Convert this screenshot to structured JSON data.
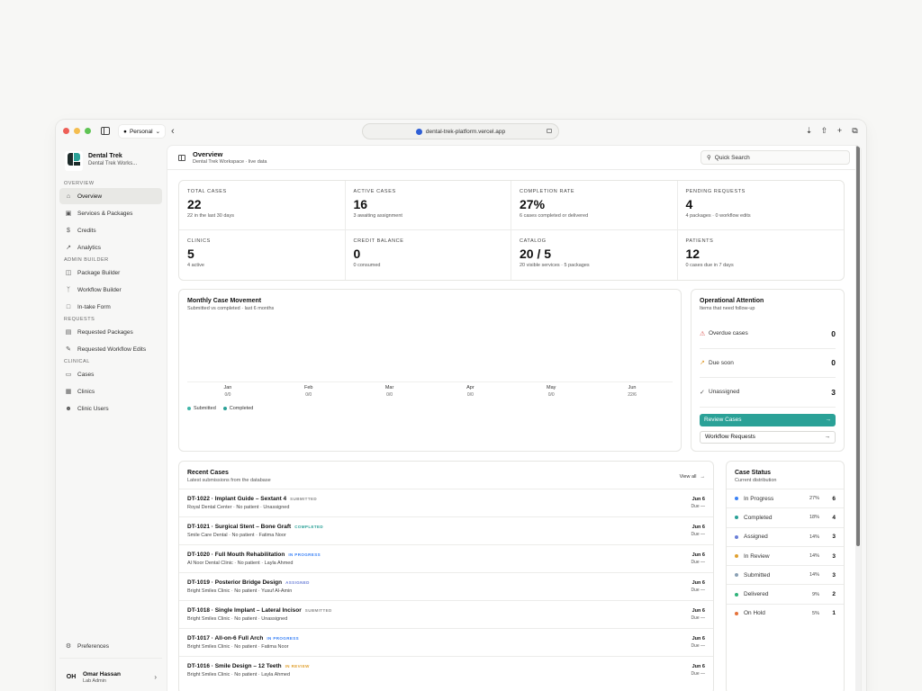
{
  "browser": {
    "profile": "Personal",
    "url": "dental-trek-platform.vercel.app"
  },
  "brand": {
    "name": "Dental Trek",
    "workspace": "Dental Trek Works..."
  },
  "nav": {
    "sections": [
      {
        "title": "OVERVIEW",
        "items": [
          {
            "label": "Overview",
            "icon": "home-icon",
            "active": true
          },
          {
            "label": "Services & Packages",
            "icon": "box-icon"
          },
          {
            "label": "Credits",
            "icon": "dollar-icon"
          },
          {
            "label": "Analytics",
            "icon": "trend-icon"
          }
        ]
      },
      {
        "title": "ADMIN BUILDER",
        "items": [
          {
            "label": "Package Builder",
            "icon": "package-icon"
          },
          {
            "label": "Workflow Builder",
            "icon": "workflow-icon"
          },
          {
            "label": "In-take Form",
            "icon": "form-icon"
          }
        ]
      },
      {
        "title": "REQUESTS",
        "items": [
          {
            "label": "Requested Packages",
            "icon": "inbox-icon"
          },
          {
            "label": "Requested Workflow Edits",
            "icon": "edit-icon"
          }
        ]
      },
      {
        "title": "CLINICAL",
        "items": [
          {
            "label": "Cases",
            "icon": "folder-icon"
          },
          {
            "label": "Clinics",
            "icon": "building-icon"
          },
          {
            "label": "Clinic Users",
            "icon": "users-icon"
          }
        ]
      }
    ],
    "preferences": "Preferences"
  },
  "user": {
    "initials": "OH",
    "name": "Omar Hassan",
    "role": "Lab Admin"
  },
  "header": {
    "title": "Overview",
    "subtitle": "Dental Trek Workspace · live data",
    "search_label": "Quick Search"
  },
  "stats": [
    {
      "label": "TOTAL CASES",
      "value": "22",
      "sub": "22 in the last 30 days"
    },
    {
      "label": "ACTIVE CASES",
      "value": "16",
      "sub": "3 awaiting assignment"
    },
    {
      "label": "COMPLETION RATE",
      "value": "27%",
      "sub": "6 cases completed or delivered"
    },
    {
      "label": "PENDING REQUESTS",
      "value": "4",
      "sub": "4 packages · 0 workflow edits"
    },
    {
      "label": "CLINICS",
      "value": "5",
      "sub": "4 active"
    },
    {
      "label": "CREDIT BALANCE",
      "value": "0",
      "sub": "0 consumed"
    },
    {
      "label": "CATALOG",
      "value": "20 / 5",
      "sub": "20 visible services · 5 packages"
    },
    {
      "label": "PATIENTS",
      "value": "12",
      "sub": "0 cases due in 7 days"
    }
  ],
  "chart": {
    "title": "Monthly Case Movement",
    "subtitle": "Submitted vs completed · last 6 months"
  },
  "chart_data": {
    "type": "bar",
    "title": "Monthly Case Movement",
    "subtitle": "Submitted vs completed · last 6 months",
    "categories": [
      "Jan",
      "Feb",
      "Mar",
      "Apr",
      "May",
      "Jun"
    ],
    "category_labels": [
      "0/0",
      "0/0",
      "0/0",
      "0/0",
      "0/0",
      "22/6"
    ],
    "series": [
      {
        "name": "Submitted",
        "values": [
          0,
          0,
          0,
          0,
          0,
          22
        ],
        "color": "#3fb5a8"
      },
      {
        "name": "Completed",
        "values": [
          0,
          0,
          0,
          0,
          0,
          6
        ],
        "color": "#2aa197"
      }
    ],
    "legend": "bottom-left"
  },
  "ops": {
    "title": "Operational Attention",
    "subtitle": "Items that need follow-up",
    "rows": [
      {
        "label": "Overdue cases",
        "count": "0",
        "icon": "warning-icon",
        "color": "#d9534f"
      },
      {
        "label": "Due soon",
        "count": "0",
        "icon": "trend-up-icon",
        "color": "#e09b2d"
      },
      {
        "label": "Unassigned",
        "count": "3",
        "icon": "check-circle-icon",
        "color": "#555555"
      }
    ],
    "primary_button": "Review Cases",
    "secondary_button": "Workflow Requests"
  },
  "cases": {
    "title": "Recent Cases",
    "subtitle": "Latest submissions from the database",
    "view_all": "View all",
    "rows": [
      {
        "title": "DT-1022 · Implant Guide – Sextant 4",
        "status": "SUBMITTED",
        "status_color": "#8a8a8a",
        "meta": "Royal Dental Center · No patient · Unassigned",
        "date": "Jun 6",
        "due": "Due —"
      },
      {
        "title": "DT-1021 · Surgical Stent – Bone Graft",
        "status": "COMPLETED",
        "status_color": "#2aa197",
        "meta": "Smile Care Dental · No patient · Fatima Noor",
        "date": "Jun 6",
        "due": "Due —"
      },
      {
        "title": "DT-1020 · Full Mouth Rehabilitation",
        "status": "IN PROGRESS",
        "status_color": "#3b82f6",
        "meta": "Al Noor Dental Clinic · No patient · Layla Ahmed",
        "date": "Jun 6",
        "due": "Due —"
      },
      {
        "title": "DT-1019 · Posterior Bridge Design",
        "status": "ASSIGNED",
        "status_color": "#6b7fd7",
        "meta": "Bright Smiles Clinic · No patient · Yusuf Al-Amin",
        "date": "Jun 6",
        "due": "Due —"
      },
      {
        "title": "DT-1018 · Single Implant – Lateral Incisor",
        "status": "SUBMITTED",
        "status_color": "#8a8a8a",
        "meta": "Bright Smiles Clinic · No patient · Unassigned",
        "date": "Jun 6",
        "due": "Due —"
      },
      {
        "title": "DT-1017 · All-on-6 Full Arch",
        "status": "IN PROGRESS",
        "status_color": "#3b82f6",
        "meta": "Bright Smiles Clinic · No patient · Fatima Noor",
        "date": "Jun 6",
        "due": "Due —"
      },
      {
        "title": "DT-1016 · Smile Design – 12 Teeth",
        "status": "IN REVIEW",
        "status_color": "#e0a030",
        "meta": "Bright Smiles Clinic · No patient · Layla Ahmed",
        "date": "Jun 6",
        "due": "Due —"
      }
    ]
  },
  "status": {
    "title": "Case Status",
    "subtitle": "Current distribution",
    "rows": [
      {
        "label": "In Progress",
        "pct": "27%",
        "count": "6",
        "color": "#3b82f6"
      },
      {
        "label": "Completed",
        "pct": "18%",
        "count": "4",
        "color": "#2aa197"
      },
      {
        "label": "Assigned",
        "pct": "14%",
        "count": "3",
        "color": "#6b7fd7"
      },
      {
        "label": "In Review",
        "pct": "14%",
        "count": "3",
        "color": "#e0a030"
      },
      {
        "label": "Submitted",
        "pct": "14%",
        "count": "3",
        "color": "#8aa0b4"
      },
      {
        "label": "Delivered",
        "pct": "9%",
        "count": "2",
        "color": "#2fb37a"
      },
      {
        "label": "On Hold",
        "pct": "5%",
        "count": "1",
        "color": "#e5723a"
      }
    ]
  }
}
